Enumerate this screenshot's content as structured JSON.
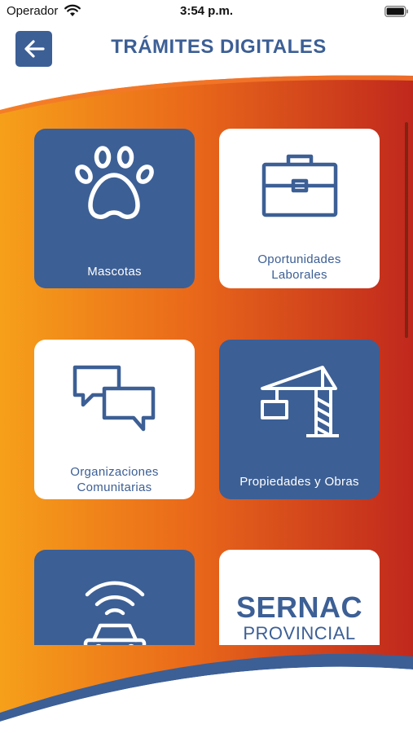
{
  "status_bar": {
    "carrier": "Operador",
    "time": "3:54 p.m."
  },
  "header": {
    "title": "TRÁMITES DIGITALES"
  },
  "tiles": [
    {
      "label": "Mascotas",
      "icon": "paw-icon",
      "style": "blue"
    },
    {
      "label": "Oportunidades\nLaborales",
      "icon": "briefcase-icon",
      "style": "white"
    },
    {
      "label": "Organizaciones\nComunitarias",
      "icon": "chat-bubbles-icon",
      "style": "white"
    },
    {
      "label": "Propiedades y Obras",
      "icon": "crane-icon",
      "style": "blue"
    },
    {
      "label": "",
      "icon": "car-signal-icon",
      "style": "blue"
    },
    {
      "label": "",
      "icon": "sernac-logo",
      "style": "white",
      "logo_text": "SERNAC",
      "logo_subtext": "PROVINCIAL"
    }
  ],
  "colors": {
    "brand_blue": "#3c5f95",
    "gradient_start": "#f6a01a",
    "gradient_end": "#c0281d"
  }
}
